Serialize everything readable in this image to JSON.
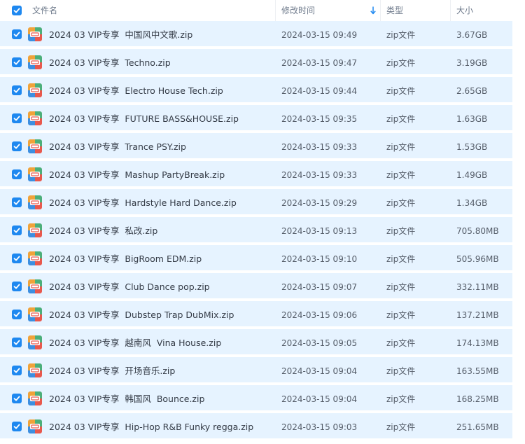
{
  "header": {
    "name": "文件名",
    "modified": "修改时间",
    "type": "类型",
    "size": "大小"
  },
  "colors": {
    "accent": "#1e88f0",
    "row_selected_bg": "#e6f3ff"
  },
  "files": [
    {
      "name": "2024 03 VIP专享  中国风中文歌.zip",
      "modified": "2024-03-15 09:49",
      "type": "zip文件",
      "size": "3.67GB",
      "selected": true
    },
    {
      "name": "2024 03 VIP专享  Techno.zip",
      "modified": "2024-03-15 09:47",
      "type": "zip文件",
      "size": "3.19GB",
      "selected": true
    },
    {
      "name": "2024 03 VIP专享  Electro House Tech.zip",
      "modified": "2024-03-15 09:44",
      "type": "zip文件",
      "size": "2.65GB",
      "selected": true
    },
    {
      "name": "2024 03 VIP专享  FUTURE BASS&HOUSE.zip",
      "modified": "2024-03-15 09:35",
      "type": "zip文件",
      "size": "1.63GB",
      "selected": true
    },
    {
      "name": "2024 03 VIP专享  Trance PSY.zip",
      "modified": "2024-03-15 09:33",
      "type": "zip文件",
      "size": "1.53GB",
      "selected": true
    },
    {
      "name": "2024 03 VIP专享  Mashup PartyBreak.zip",
      "modified": "2024-03-15 09:33",
      "type": "zip文件",
      "size": "1.49GB",
      "selected": true
    },
    {
      "name": "2024 03 VIP专享  Hardstyle Hard Dance.zip",
      "modified": "2024-03-15 09:29",
      "type": "zip文件",
      "size": "1.34GB",
      "selected": true
    },
    {
      "name": "2024 03 VIP专享  私改.zip",
      "modified": "2024-03-15 09:13",
      "type": "zip文件",
      "size": "705.80MB",
      "selected": true
    },
    {
      "name": "2024 03 VIP专享  BigRoom EDM.zip",
      "modified": "2024-03-15 09:10",
      "type": "zip文件",
      "size": "505.96MB",
      "selected": true
    },
    {
      "name": "2024 03 VIP专享  Club Dance pop.zip",
      "modified": "2024-03-15 09:07",
      "type": "zip文件",
      "size": "332.11MB",
      "selected": true
    },
    {
      "name": "2024 03 VIP专享  Dubstep Trap DubMix.zip",
      "modified": "2024-03-15 09:06",
      "type": "zip文件",
      "size": "137.21MB",
      "selected": true
    },
    {
      "name": "2024 03 VIP专享  越南风  Vina House.zip",
      "modified": "2024-03-15 09:05",
      "type": "zip文件",
      "size": "174.13MB",
      "selected": true
    },
    {
      "name": "2024 03 VIP专享  开场音乐.zip",
      "modified": "2024-03-15 09:04",
      "type": "zip文件",
      "size": "163.55MB",
      "selected": true
    },
    {
      "name": "2024 03 VIP专享  韩国风  Bounce.zip",
      "modified": "2024-03-15 09:04",
      "type": "zip文件",
      "size": "168.25MB",
      "selected": true
    },
    {
      "name": "2024 03 VIP专享  Hip-Hop R&B Funky regga.zip",
      "modified": "2024-03-15 09:03",
      "type": "zip文件",
      "size": "251.65MB",
      "selected": true
    }
  ]
}
